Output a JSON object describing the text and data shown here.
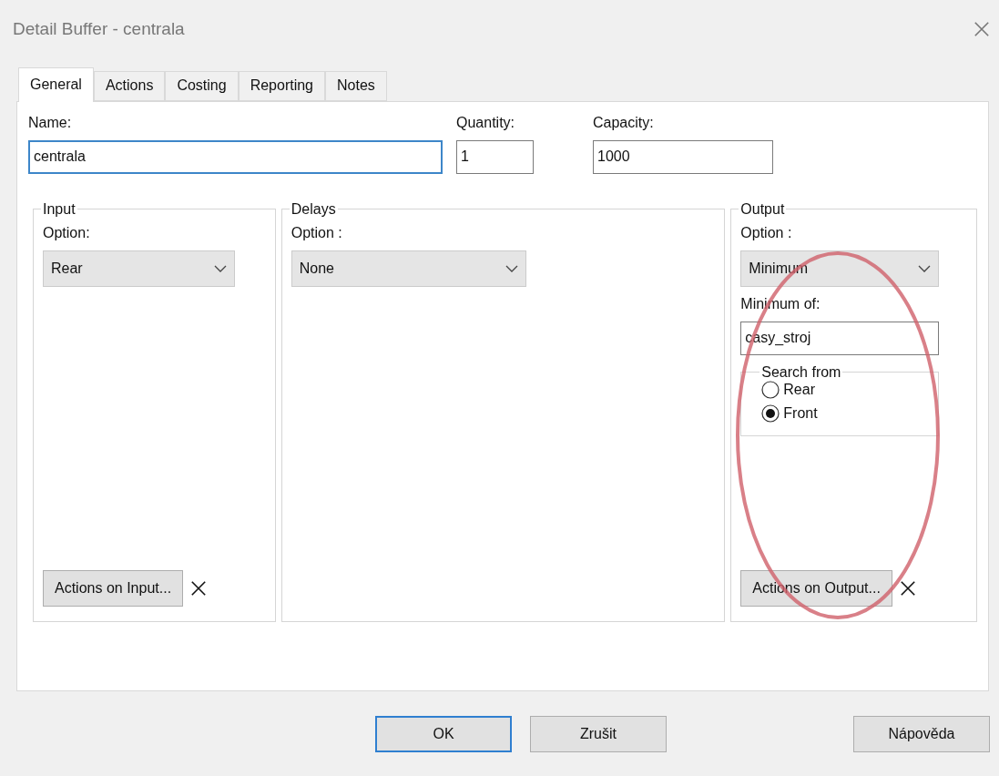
{
  "window": {
    "title": "Detail Buffer - centrala"
  },
  "tabs": [
    {
      "label": "General",
      "selected": true
    },
    {
      "label": "Actions",
      "selected": false
    },
    {
      "label": "Costing",
      "selected": false
    },
    {
      "label": "Reporting",
      "selected": false
    },
    {
      "label": "Notes",
      "selected": false
    }
  ],
  "fields": [
    {
      "label": "Name:",
      "value": "centrala",
      "focused": true
    },
    {
      "label": "Quantity:",
      "value": "1",
      "focused": false
    },
    {
      "label": "Capacity:",
      "value": "1000",
      "focused": false
    }
  ],
  "input": {
    "title": "Input",
    "option_label": "Option:",
    "option": "Rear",
    "action_button": "Actions on Input..."
  },
  "delays": {
    "title": "Delays",
    "option_label": "Option :",
    "option": "None"
  },
  "output": {
    "title": "Output",
    "option_label": "Option :",
    "option": "Minimum",
    "minimum_of_label": "Minimum of:",
    "minimum_of": "casy_stroj",
    "search_from": {
      "title": "Search from",
      "options": [
        {
          "label": "Rear",
          "selected": false
        },
        {
          "label": "Front",
          "selected": true
        }
      ]
    },
    "action_button": "Actions on Output..."
  },
  "buttons": [
    {
      "label": "OK",
      "default": true
    },
    {
      "label": "Zrušit",
      "default": false
    },
    {
      "label": "Nápověda",
      "default": false
    }
  ]
}
